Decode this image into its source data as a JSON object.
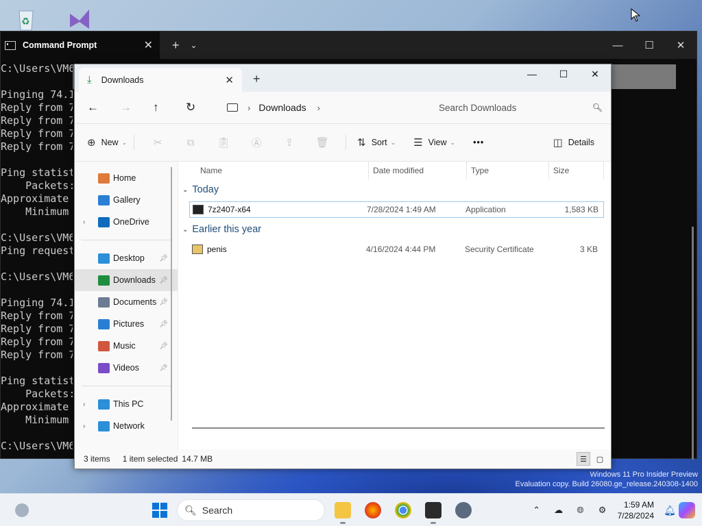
{
  "terminal": {
    "tab_title": "Command Prompt",
    "lines": [
      "C:\\Users\\VM6",
      "",
      "Pinging 74.1",
      "Reply from 7",
      "Reply from 7",
      "Reply from 7",
      "Reply from 7",
      "",
      "Ping statist",
      "    Packets:",
      "Approximate ",
      "    Minimum =",
      "",
      "C:\\Users\\VM6",
      "Ping request",
      "",
      "C:\\Users\\VM6",
      "",
      "Pinging 74.1",
      "Reply from 7",
      "Reply from 7",
      "Reply from 7",
      "Reply from 7",
      "",
      "Ping statist",
      "    Packets:",
      "Approximate ",
      "    Minimum =",
      "",
      "C:\\Users\\VM6"
    ]
  },
  "explorer": {
    "tab_title": "Downloads",
    "breadcrumb": "Downloads",
    "search_placeholder": "Search Downloads",
    "commands": {
      "new": "New",
      "sort": "Sort",
      "view": "View",
      "more": "•••",
      "details": "Details"
    },
    "nav": {
      "top": [
        {
          "label": "Home",
          "icon": "home-icon",
          "color": "#e07a3a"
        },
        {
          "label": "Gallery",
          "icon": "gallery-icon",
          "color": "#2a7fd4"
        },
        {
          "label": "OneDrive",
          "icon": "cloud-icon",
          "color": "#0f6cbd"
        }
      ],
      "pinned": [
        {
          "label": "Desktop",
          "icon": "desktop-icon",
          "color": "#2b8fd9"
        },
        {
          "label": "Downloads",
          "icon": "download-icon",
          "color": "#1e8e3e"
        },
        {
          "label": "Documents",
          "icon": "documents-icon",
          "color": "#6b7c93"
        },
        {
          "label": "Pictures",
          "icon": "pictures-icon",
          "color": "#2a7fd4"
        },
        {
          "label": "Music",
          "icon": "music-icon",
          "color": "#d2553f"
        },
        {
          "label": "Videos",
          "icon": "videos-icon",
          "color": "#7b4cc7"
        }
      ],
      "bottom": [
        {
          "label": "This PC",
          "icon": "pc-icon",
          "color": "#2b8fd9"
        },
        {
          "label": "Network",
          "icon": "network-icon",
          "color": "#2b8fd9"
        }
      ]
    },
    "columns": [
      "Name",
      "Date modified",
      "Type",
      "Size"
    ],
    "groups": [
      {
        "label": "Today",
        "files": [
          {
            "name": "7z2407-x64",
            "date": "7/28/2024 1:49 AM",
            "type": "Application",
            "size": "1,583 KB",
            "icon": "7zip-icon",
            "selected": true
          }
        ]
      },
      {
        "label": "Earlier this year",
        "files": [
          {
            "name": "penis",
            "date": "4/16/2024 4:44 PM",
            "type": "Security Certificate",
            "size": "3 KB",
            "icon": "certificate-icon",
            "selected": false
          }
        ]
      }
    ],
    "status": {
      "items": "3 items",
      "selected": "1 item selected",
      "selected_size": "14.7 MB"
    }
  },
  "desktop": {
    "watermark_line1": "Windows 11 Pro Insider Preview",
    "watermark_line2": "Evaluation copy. Build 26080.ge_release.240308-1400"
  },
  "taskbar": {
    "search_label": "Search",
    "time": "1:59 AM",
    "date": "7/28/2024"
  }
}
